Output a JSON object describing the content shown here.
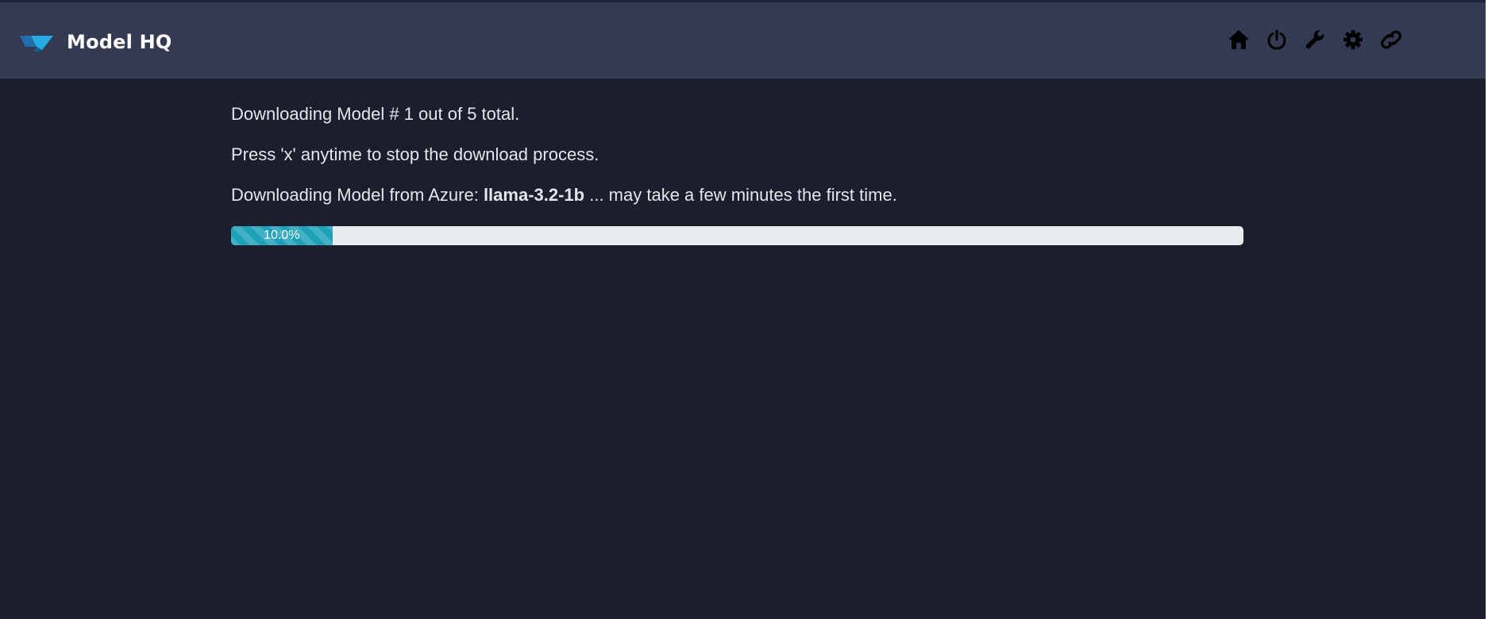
{
  "app": {
    "title": "Model HQ"
  },
  "navbar": {
    "icons": [
      {
        "name": "home-icon"
      },
      {
        "name": "power-icon"
      },
      {
        "name": "wrench-icon"
      },
      {
        "name": "gear-icon"
      },
      {
        "name": "link-icon"
      }
    ]
  },
  "download": {
    "status_line": "Downloading Model # 1 out of 5 total.",
    "stop_hint": "Press 'x' anytime to stop the download process.",
    "source_prefix": "Downloading Model from Azure: ",
    "model_name": "llama-3.2-1b",
    "source_suffix": " ... may take a few minutes the first time.",
    "progress_label": "10.0%",
    "progress_fraction": 0.1
  },
  "colors": {
    "navbar_bg": "#343a52",
    "page_bg": "#1b1f2d",
    "progress_fill": "#1fa2b8",
    "progress_track": "#e9ecef",
    "logo_blue": "#1e7fc0",
    "logo_cyan": "#27a9e1"
  }
}
